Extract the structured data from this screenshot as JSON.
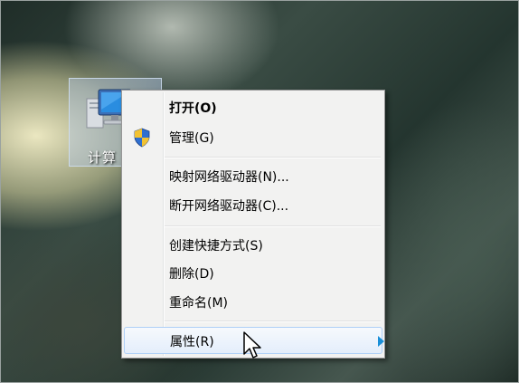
{
  "desktop": {
    "icon_label": "计算"
  },
  "context_menu": {
    "items": [
      {
        "label": "打开(O)"
      },
      {
        "label": "管理(G)"
      },
      {
        "label": "映射网络驱动器(N)..."
      },
      {
        "label": "断开网络驱动器(C)..."
      },
      {
        "label": "创建快捷方式(S)"
      },
      {
        "label": "删除(D)"
      },
      {
        "label": "重命名(M)"
      },
      {
        "label": "属性(R)"
      }
    ]
  },
  "icons": {
    "computer": "computer-icon",
    "shield": "uac-shield-icon",
    "cursor": "mouse-cursor-icon",
    "arrow": "submenu-arrow-icon"
  },
  "colors": {
    "menu_background": "#f2f2f1",
    "highlight_border": "#aecff7",
    "arrow": "#1a8fd8"
  }
}
